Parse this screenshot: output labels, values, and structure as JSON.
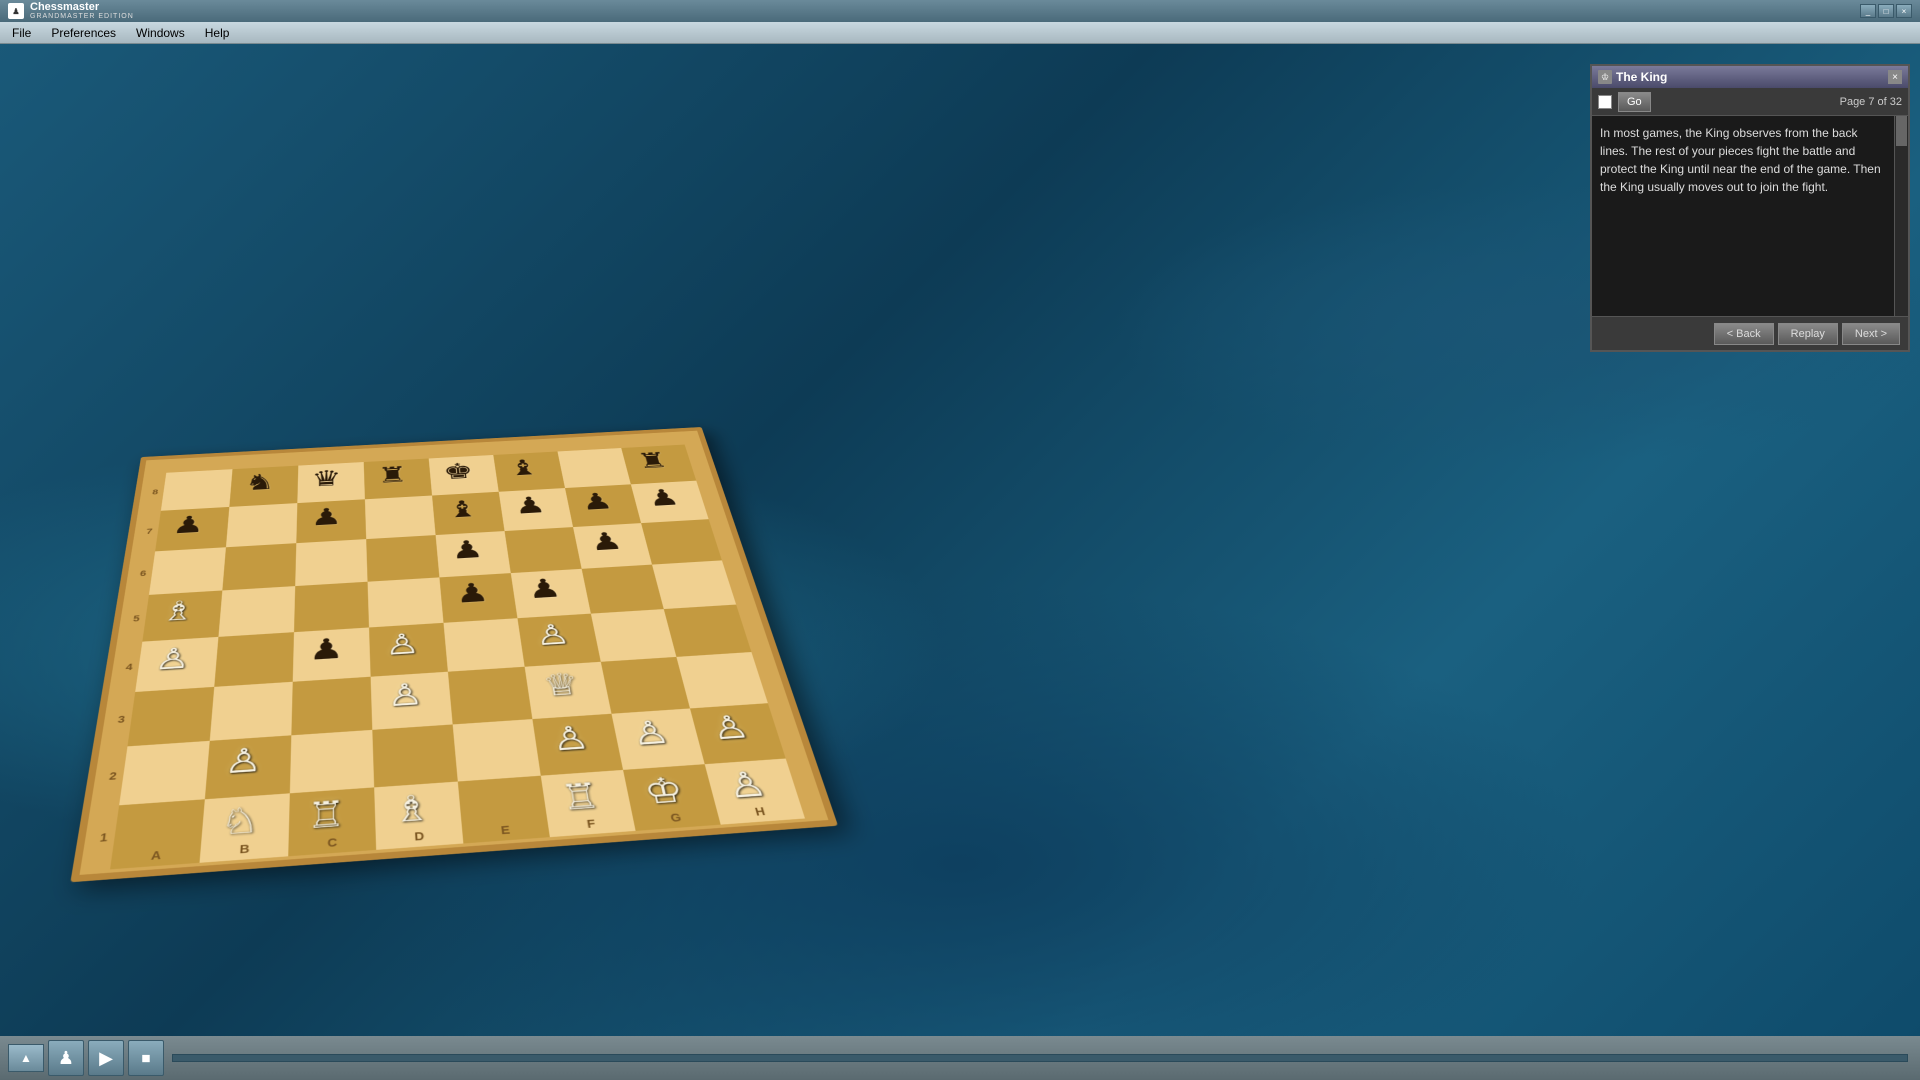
{
  "titleBar": {
    "appName": "Chessmaster",
    "subtitle": "GRANDMASTER EDITION",
    "minimizeLabel": "_",
    "maximizeLabel": "□",
    "closeLabel": "×"
  },
  "menuBar": {
    "items": [
      "File",
      "Preferences",
      "Windows",
      "Help"
    ]
  },
  "lessonPanel": {
    "title": "The King",
    "closeLabel": "×",
    "goLabel": "Go",
    "pageInfo": "Page 7 of 32",
    "content": "In most games, the King observes from the back lines. The rest of your pieces fight the battle and protect the King until near the end of the game. Then the King usually moves out to join the fight.",
    "backLabel": "< Back",
    "replayLabel": "Replay",
    "nextLabel": "Next >"
  },
  "board": {
    "rankLabels": [
      "8",
      "7",
      "6",
      "5",
      "4",
      "3",
      "2",
      "1"
    ],
    "fileLabels": [
      "A",
      "B",
      "C",
      "D",
      "E",
      "F",
      "G",
      "H"
    ]
  },
  "bottomBar": {
    "scrollUpLabel": "▲",
    "playLabel": "▶",
    "stopLabel": "⏹"
  }
}
